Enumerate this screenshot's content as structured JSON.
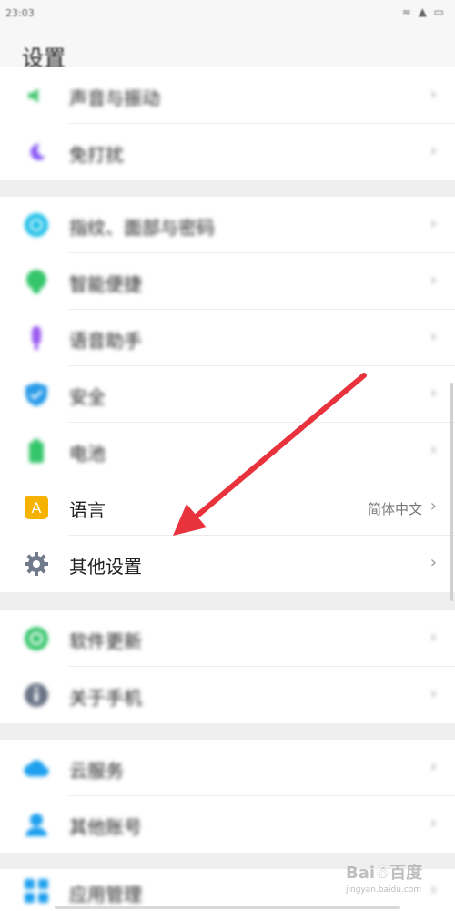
{
  "status_bar": {
    "time": "23:03",
    "signal": "≈ ▲ ▭"
  },
  "header": {
    "title": "设置"
  },
  "groups": [
    {
      "items": [
        {
          "label": "声音与振动",
          "icon": "speaker-icon",
          "color": "#3ec46d"
        },
        {
          "label": "免打扰",
          "icon": "moon-icon",
          "color": "#8a5cf5"
        }
      ]
    },
    {
      "items": [
        {
          "label": "指纹、面部与密码",
          "icon": "fingerprint-icon",
          "color": "#1ec0e8"
        },
        {
          "label": "智能便捷",
          "icon": "smart-icon",
          "color": "#35c56b"
        },
        {
          "label": "语音助手",
          "icon": "microphone-icon",
          "color": "#9b5cf0"
        },
        {
          "label": "安全",
          "icon": "shield-icon",
          "color": "#2a9be8"
        },
        {
          "label": "电池",
          "icon": "battery-icon",
          "color": "#35c56b"
        },
        {
          "label": "语言",
          "value": "简体中文",
          "icon": "language-icon",
          "color": "#f5b300",
          "glyph": "A"
        },
        {
          "label": "其他设置",
          "icon": "gear-icon",
          "color": "#707a8a"
        }
      ]
    },
    {
      "items": [
        {
          "label": "软件更新",
          "icon": "update-icon",
          "color": "#35c56b"
        },
        {
          "label": "关于手机",
          "icon": "info-icon",
          "color": "#6b7486"
        }
      ]
    },
    {
      "items": [
        {
          "label": "云服务",
          "icon": "cloud-icon",
          "color": "#1ea0ee"
        },
        {
          "label": "其他账号",
          "icon": "person-icon",
          "color": "#1ea0ee"
        }
      ]
    },
    {
      "items": [
        {
          "label": "应用管理",
          "icon": "apps-icon",
          "color": "#1ea0ee"
        }
      ]
    }
  ],
  "chevron": "›",
  "annotation": {
    "arrow_color": "#e8323c"
  },
  "watermark": {
    "text": "Bai☃百度",
    "sub": "jingyan.baidu.com"
  }
}
